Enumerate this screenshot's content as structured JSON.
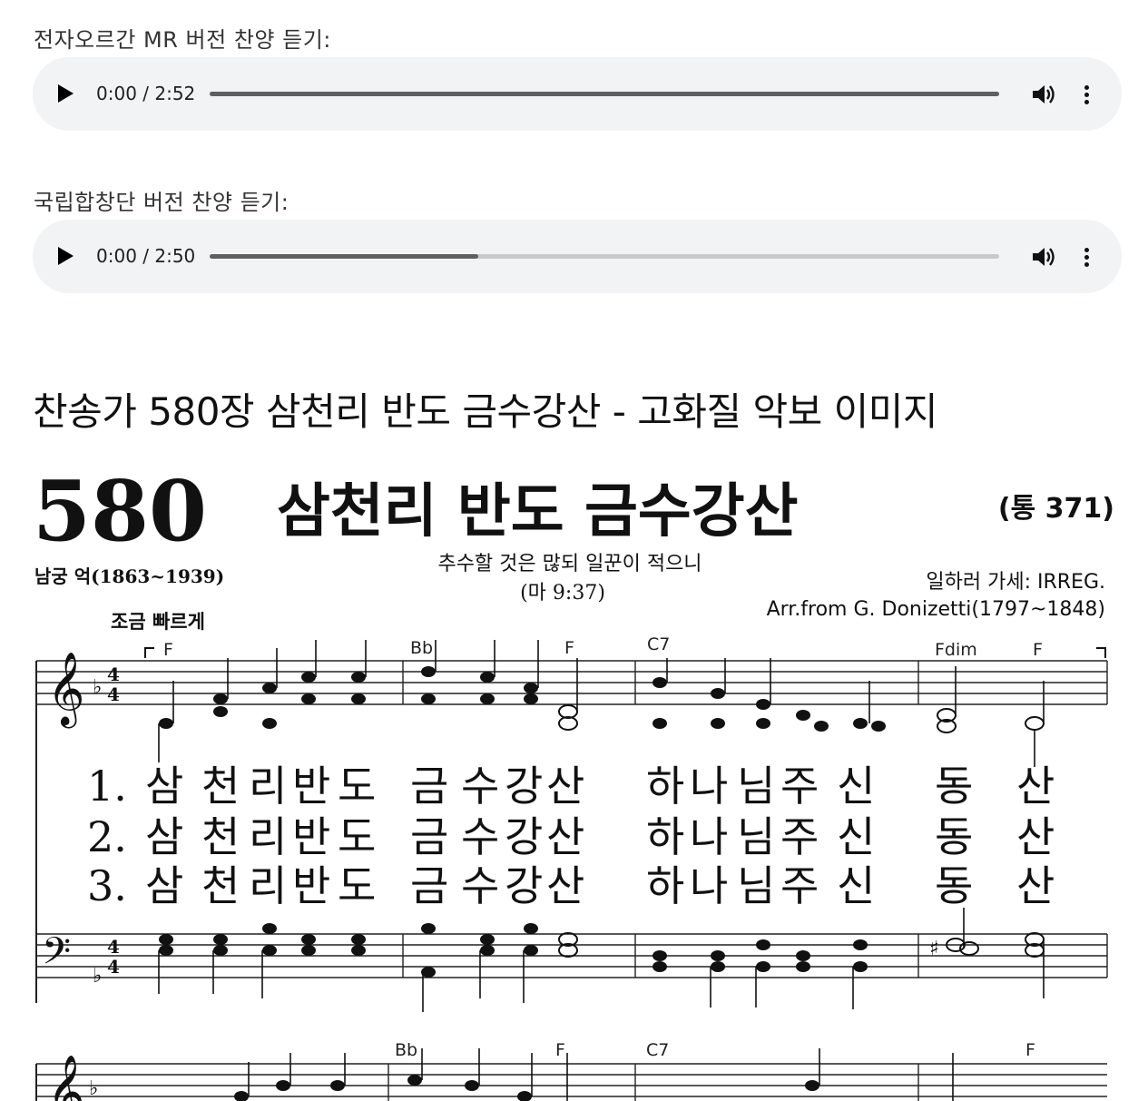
{
  "players": [
    {
      "label": "전자오르간 MR 버전 찬양 듣기:",
      "time": "0:00 / 2:52",
      "progress": 1.0
    },
    {
      "label": "국립합창단 버전 찬양 듣기:",
      "time": "0:00 / 2:50",
      "progress": 0.34
    }
  ],
  "heading": "찬송가 580장 삼천리 반도 금수강산 - 고화질 악보 이미지",
  "score": {
    "number": "580",
    "title": "삼천리 반도 금수강산",
    "tong": "(통 371)",
    "subtitle": "추수할 것은 많되 일꾼이 적으니",
    "scripture": "(마 9:37)",
    "author": "남궁 억(1863~1939)",
    "tempo": "조금 빠르게",
    "tune": "일하러 가세: IRREG.",
    "arranger": "Arr.from G. Donizetti(1797~1848)",
    "chords_row1": [
      "F",
      "Bb",
      "F",
      "C7",
      "Fdim",
      "F"
    ],
    "chords_row2": [
      "Bb",
      "F",
      "C7",
      "F"
    ],
    "lyrics": [
      {
        "num": "1.",
        "syllables": [
          "삼",
          "천",
          "리",
          "반",
          "도",
          "금",
          "수",
          "강",
          "산",
          "하",
          "나",
          "님",
          "주",
          "신",
          "동",
          "산"
        ]
      },
      {
        "num": "2.",
        "syllables": [
          "삼",
          "천",
          "리",
          "반",
          "도",
          "금",
          "수",
          "강",
          "산",
          "하",
          "나",
          "님",
          "주",
          "신",
          "동",
          "산"
        ]
      },
      {
        "num": "3.",
        "syllables": [
          "삼",
          "천",
          "리",
          "반",
          "도",
          "금",
          "수",
          "강",
          "산",
          "하",
          "나",
          "님",
          "주",
          "신",
          "동",
          "산"
        ]
      }
    ]
  }
}
